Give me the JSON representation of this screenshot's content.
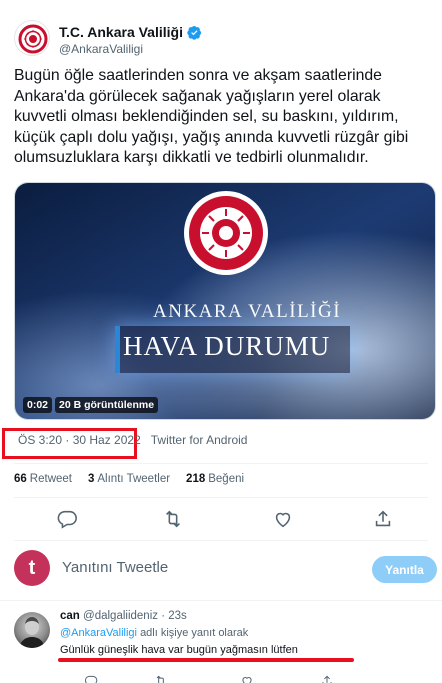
{
  "account": {
    "display_name": "T.C. Ankara Valiliği",
    "handle": "@AnkaraValiligi",
    "verified_icon": "verified-badge-icon",
    "verified_color": "#1d9bf0"
  },
  "tweet": {
    "text": "Bugün öğle saatlerinden sonra ve akşam saatlerinde\nAnkara'da görülecek sağanak yağışların yerel olarak\nkuvvetli olması beklendiğinden sel, su baskını, yıldırım,\nküçük çaplı dolu yağışı, yağış anında kuvvetli rüzgâr gibi\nolumsuzluklara karşı dikkatli ve tedbirli olunmalıdır.",
    "media": {
      "title_line_1": "ANKARA VALİLİĞİ",
      "title_line_2": "HAVA DURUMU",
      "duration": "0:02",
      "views": "20 B görüntülenme"
    },
    "timestamp": "ÖS 3:20 · 30 Haz 2022",
    "source": "Twitter for Android",
    "highlight_color": "#e8101e"
  },
  "stats": {
    "retweets_count": "66",
    "retweets_label": "Retweet",
    "quotes_count": "3",
    "quotes_label": "Alıntı Tweetler",
    "likes_count": "218",
    "likes_label": "Beğeni"
  },
  "actions": [
    "reply-icon",
    "retweet-icon",
    "like-icon",
    "share-icon"
  ],
  "compose": {
    "avatar_letter": "t",
    "placeholder": "Yanıtını Tweetle",
    "button_label": "Yanıtla",
    "button_color": "#8ecdf8"
  },
  "reply": {
    "name": "can",
    "handle": "@dalgaliideniz",
    "time": "23s",
    "replying_mention": "@AnkaraValiligi",
    "replying_suffix": "adlı kişiye yanıt olarak",
    "text": "Günlük güneşlik hava var bugün yağmasın lütfen"
  },
  "colors": {
    "accent": "#1d9bf0",
    "secondary_text": "#536471"
  }
}
